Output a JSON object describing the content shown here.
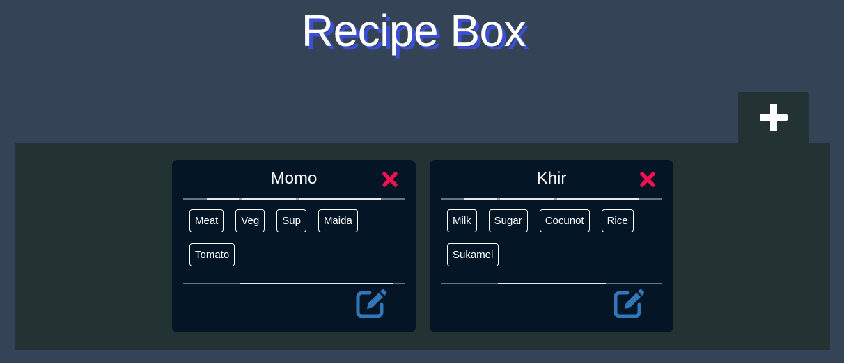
{
  "header": {
    "title": "Recipe Box"
  },
  "add_button": {
    "icon": "plus-icon"
  },
  "recipes": [
    {
      "name": "Momo",
      "ingredients": [
        "Meat",
        "Veg",
        "Sup",
        "Maida",
        "Tomato"
      ]
    },
    {
      "name": "Khir",
      "ingredients": [
        "Milk",
        "Sugar",
        "Cocunot",
        "Rice",
        "Sukamel"
      ]
    }
  ],
  "colors": {
    "background": "#344456",
    "panel": "#233333",
    "card": "#041526",
    "title_shadow": "#3a4fd4",
    "delete_icon": "#f0124f",
    "edit_icon": "#3377b8"
  }
}
